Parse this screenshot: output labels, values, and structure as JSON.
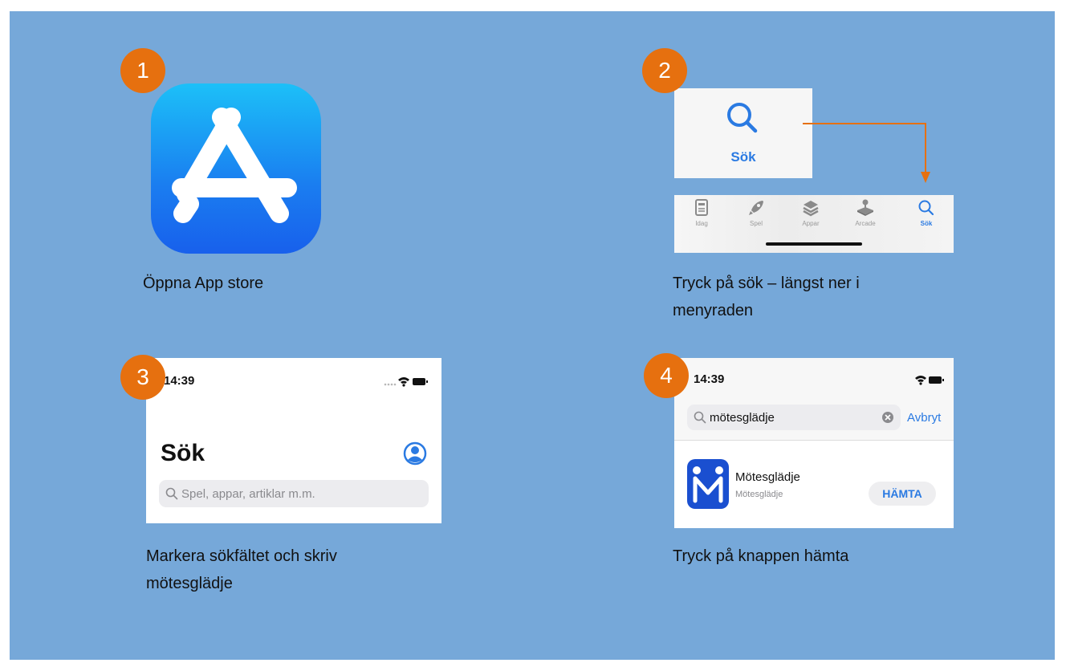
{
  "steps": [
    {
      "number": "1",
      "caption_line1": "Öppna App store"
    },
    {
      "number": "2",
      "caption_line1": "Tryck på sök – längst ner i",
      "caption_line2": "menyraden"
    },
    {
      "number": "3",
      "caption_line1": "Markera sökfältet och skriv",
      "caption_line2": "mötesglädje"
    },
    {
      "number": "4",
      "caption_line1": "Tryck på knappen hämta"
    }
  ],
  "step2": {
    "search_label": "Sök",
    "tabs": [
      {
        "label": "Idag",
        "icon": "today-icon"
      },
      {
        "label": "Spel",
        "icon": "rocket-icon"
      },
      {
        "label": "Appar",
        "icon": "layers-icon"
      },
      {
        "label": "Arcade",
        "icon": "joystick-icon"
      },
      {
        "label": "Sök",
        "icon": "search-icon"
      }
    ]
  },
  "step3": {
    "time": "14:39",
    "title": "Sök",
    "search_placeholder": "Spel, appar, artiklar m.m."
  },
  "step4": {
    "time": "14:39",
    "search_value": "mötesglädje",
    "cancel_label": "Avbryt",
    "app_name": "Mötesglädje",
    "app_developer": "Mötesglädje",
    "get_button": "HÄMTA"
  },
  "colors": {
    "background": "#76a8d9",
    "badge": "#e6700f",
    "accent_blue": "#2a7ae2",
    "arrow": "#e6700f"
  }
}
